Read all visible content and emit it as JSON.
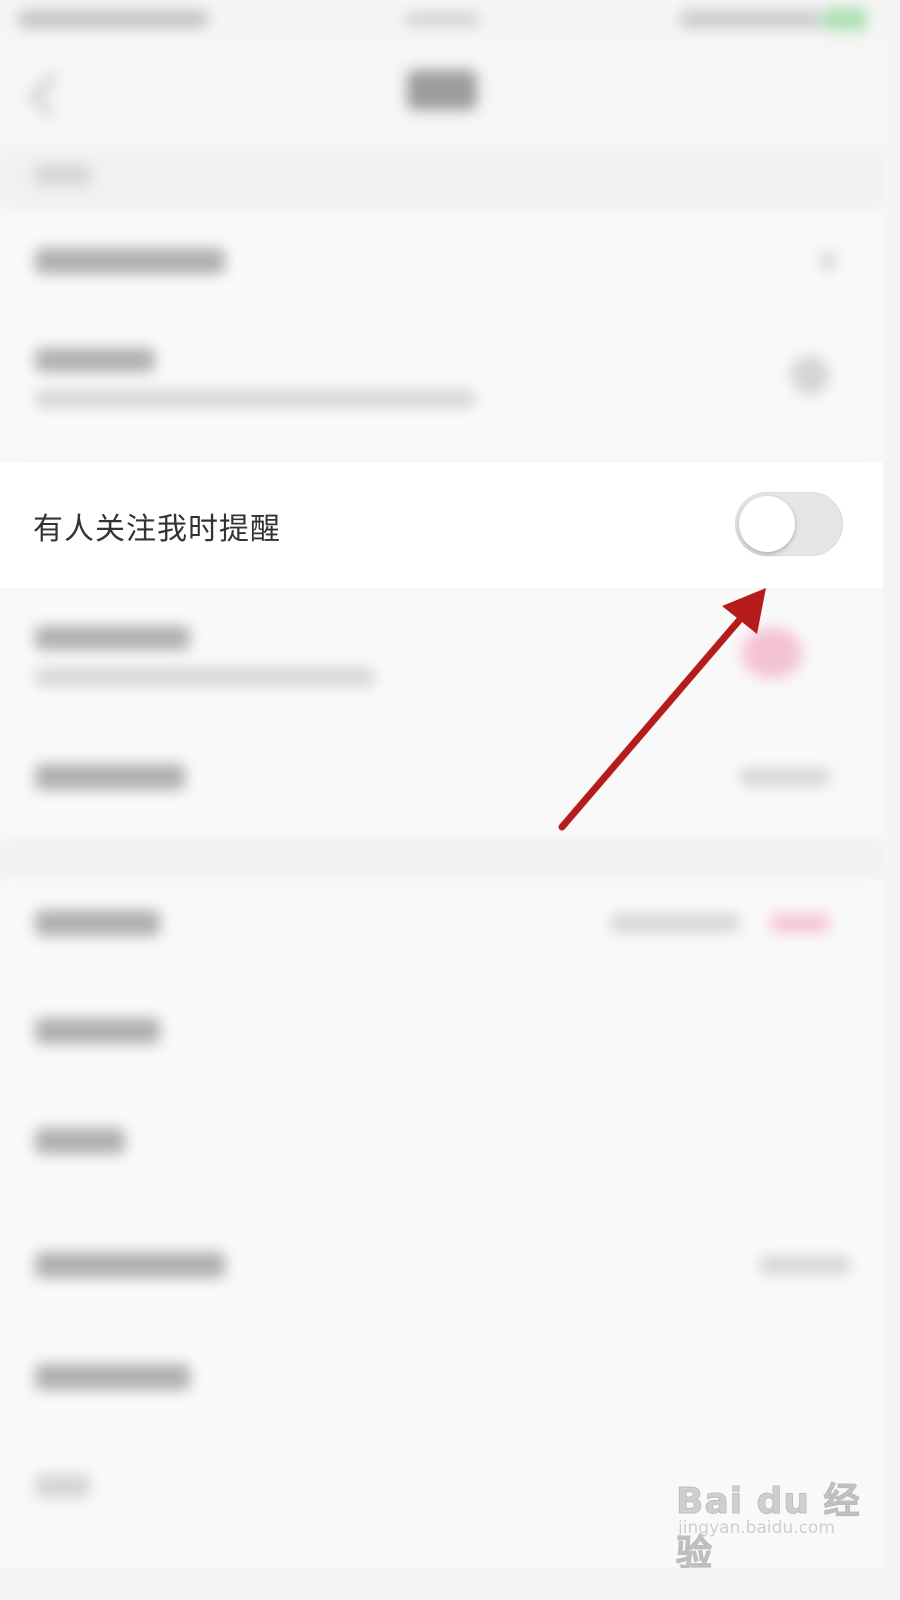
{
  "settings": {
    "follow_notify_label": "有人关注我时提醒",
    "follow_notify_toggle": {
      "state": "off"
    }
  },
  "annotation": {
    "arrow_color": "#b71c1c",
    "arrow_target": "follow-notify-toggle"
  },
  "watermark": {
    "brand": "Bai du 经验",
    "url": "jingyan.baidu.com"
  },
  "colors": {
    "toggle_off_track": "#e6e6e6",
    "toggle_knob": "#ffffff",
    "blurred_accent": "#f39ab3"
  }
}
